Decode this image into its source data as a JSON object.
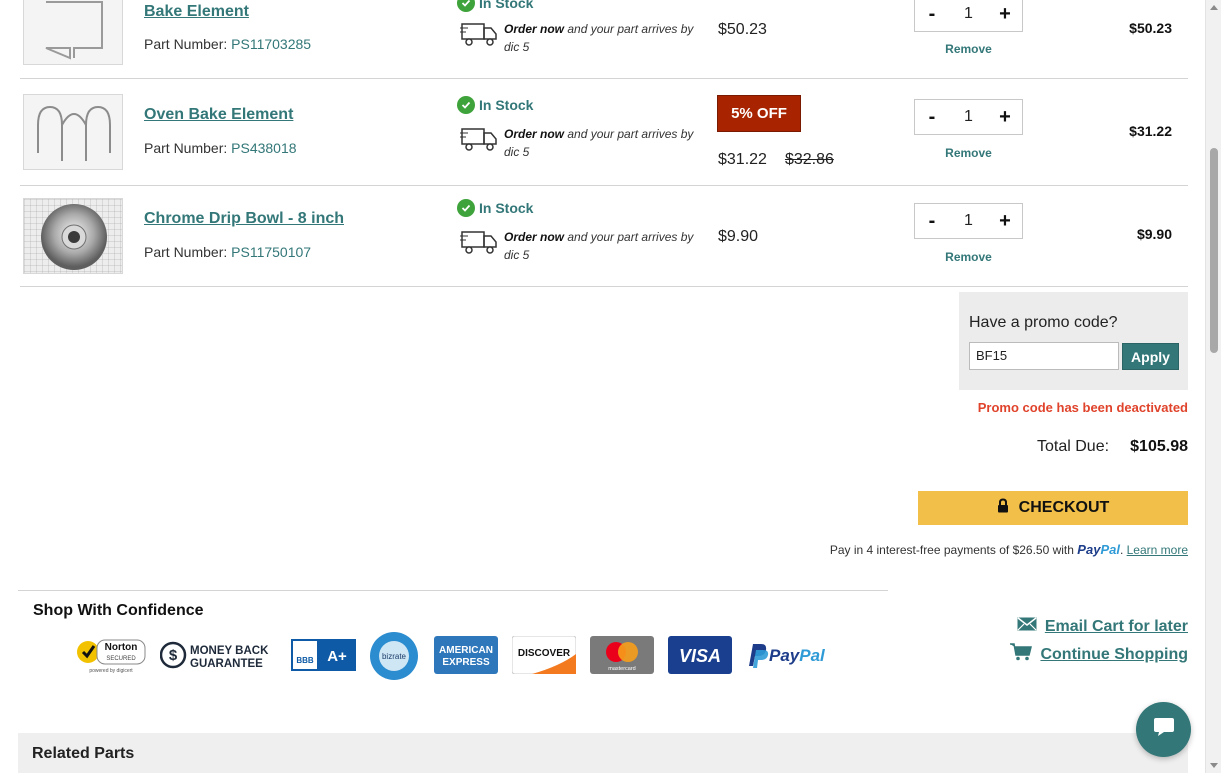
{
  "cart": {
    "items": [
      {
        "name": "Bake Element",
        "part_label": "Part Number:",
        "part_number": "PS11703285",
        "stock": "In Stock",
        "ship_bold": "Order now",
        "ship_text": " and your part arrives by dic 5",
        "price": "$50.23",
        "quantity": "1",
        "remove": "Remove",
        "line_total": "$50.23",
        "image_icon": "bake-element-image"
      },
      {
        "name": "Oven Bake Element",
        "part_label": "Part Number:",
        "part_number": "PS438018",
        "stock": "In Stock",
        "ship_bold": "Order now",
        "ship_text": " and your part arrives by dic 5",
        "discount_badge": "5% OFF",
        "price": "$31.22",
        "original_price": "$32.86",
        "quantity": "1",
        "remove": "Remove",
        "line_total": "$31.22",
        "image_icon": "oven-bake-element-image"
      },
      {
        "name": "Chrome Drip Bowl - 8 inch",
        "part_label": "Part Number:",
        "part_number": "PS11750107",
        "stock": "In Stock",
        "ship_bold": "Order now",
        "ship_text": " and your part arrives by dic 5",
        "price": "$9.90",
        "quantity": "1",
        "remove": "Remove",
        "line_total": "$9.90",
        "image_icon": "drip-bowl-image"
      }
    ],
    "minus_label": "-",
    "plus_label": "+"
  },
  "promo": {
    "title": "Have a promo code?",
    "value": "BF15",
    "apply_label": "Apply",
    "error": "Promo code has been deactivated"
  },
  "totals": {
    "label": "Total Due:",
    "value": "$105.98"
  },
  "checkout": {
    "label": "CHECKOUT",
    "paypal_note": "Pay in 4 interest-free payments of $26.50 with",
    "paypal_word_1": "Pay",
    "paypal_word_2": "Pal",
    "learn_more": "Learn more"
  },
  "confidence": {
    "title": "Shop With Confidence",
    "badges": {
      "norton": "Norton",
      "norton_sub": "SECURED",
      "norton_powered": "powered by digicert",
      "money_back_1": "MONEY BACK",
      "money_back_2": "GUARANTEE",
      "bbb": "BBB",
      "bbb_rating": "A+",
      "bizrate": "bizrate",
      "amex_1": "AMERICAN",
      "amex_2": "EXPRESS",
      "discover": "DISCOVER",
      "mastercard": "mastercard",
      "visa": "VISA",
      "paypal_1": "Pay",
      "paypal_2": "Pal"
    }
  },
  "links": {
    "email_cart": "Email Cart for later",
    "continue_shopping": "Continue Shopping"
  },
  "related": {
    "title": "Related Parts"
  },
  "colors": {
    "accent": "#337778",
    "checkout": "#f2bf49",
    "error": "#e0432b",
    "discount": "#a82400",
    "in_stock": "#3ea33a"
  }
}
